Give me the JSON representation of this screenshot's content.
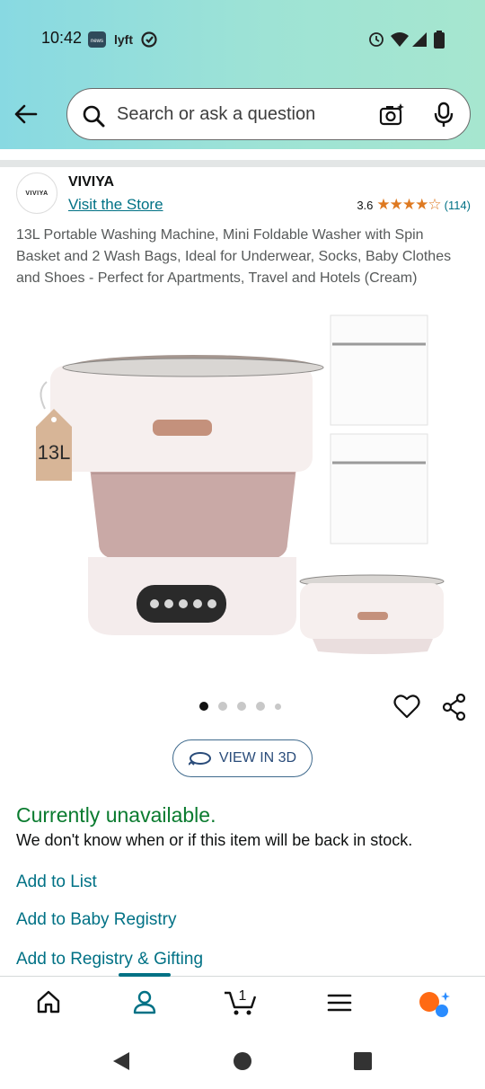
{
  "status_bar": {
    "time": "10:42",
    "left_icons": [
      "news-app-icon",
      "lyft-icon",
      "sync-icon"
    ],
    "right_icons": [
      "alarm-icon",
      "wifi-icon",
      "signal-icon",
      "battery-icon"
    ]
  },
  "search": {
    "placeholder": "Search or ask a question"
  },
  "brand": {
    "logo_text": "VIVIYA",
    "name": "VIVIYA",
    "visit_store": "Visit the Store",
    "rating": "3.6",
    "stars": "★★★★☆",
    "review_count": "(114)"
  },
  "product": {
    "title": "13L Portable Washing Machine, Mini Foldable Washer with Spin Basket and 2 Wash Bags, Ideal for Underwear, Socks, Baby Clothes and Shoes - Perfect for Apartments, Travel and Hotels (Cream)",
    "tag_label": "13L",
    "image_count": 5,
    "active_image": 0
  },
  "actions": {
    "view_3d": "VIEW IN 3D"
  },
  "availability": {
    "status": "Currently unavailable.",
    "message": "We don't know when or if this item will be back in stock."
  },
  "links": {
    "add_to_list": "Add to List",
    "add_to_baby_registry": "Add to Baby Registry",
    "add_to_registry_gifting": "Add to Registry & Gifting"
  },
  "bottom_nav": {
    "cart_count": "1",
    "active_tab": "account"
  },
  "colors": {
    "link": "#007185",
    "unavailable": "#0a7b2f",
    "star": "#de7921",
    "header_gradient_start": "#88d9e2",
    "header_gradient_end": "#a6e6cf"
  }
}
